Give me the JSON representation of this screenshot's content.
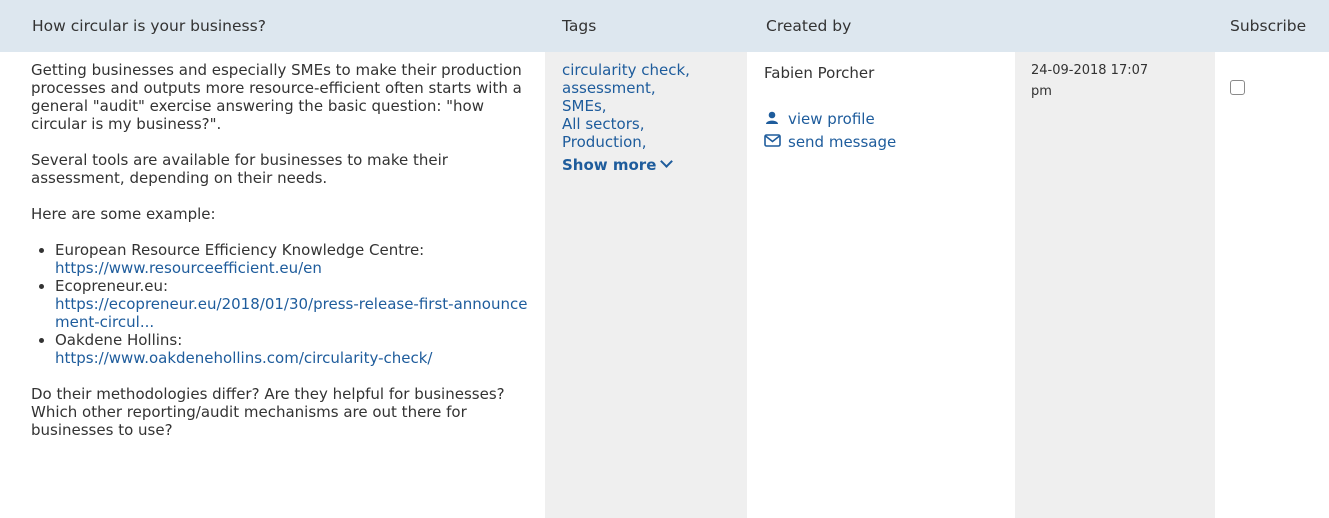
{
  "header": {
    "question": "How circular is your business?",
    "tags": "Tags",
    "created_by": "Created by",
    "subscribe": "Subscribe"
  },
  "post": {
    "paragraphs": [
      "Getting businesses and especially SMEs to make their production processes and outputs more resource-efficient often starts with a general \"audit\" exercise answering the basic question: \"how circular is my business?\".",
      "Several tools are available for businesses to make their assessment, depending on their needs.",
      "Here are some example:",
      "Do their methodologies differ? Are they helpful for businesses? Which other reporting/audit mechanisms are out there for businesses to use?"
    ],
    "examples": [
      {
        "name": "European Resource Efficiency Knowledge Centre:",
        "url": "https://www.resourceefficient.eu/en"
      },
      {
        "name": "Ecopreneur.eu:",
        "url": "https://ecopreneur.eu/2018/01/30/press-release-first-announcement-circul..."
      },
      {
        "name": "Oakdene Hollins:",
        "url": "https://www.oakdenehollins.com/circularity-check/"
      }
    ]
  },
  "tags": {
    "items": [
      "circularity check,",
      "assessment,",
      "SMEs,",
      "All sectors,",
      "Production,"
    ],
    "show_more": "Show more"
  },
  "creator": {
    "name": "Fabien Porcher",
    "view_profile": "view profile",
    "send_message": "send message"
  },
  "date": {
    "datetime": "24-09-2018 17:07",
    "ampm": "pm"
  },
  "icons": {
    "profile": "user-icon",
    "message": "envelope-icon",
    "show_more": "chevron-down-icon"
  },
  "colors": {
    "header_bg": "#dde7ef",
    "link": "#1e5c9c",
    "column_bg": "#efefef"
  }
}
